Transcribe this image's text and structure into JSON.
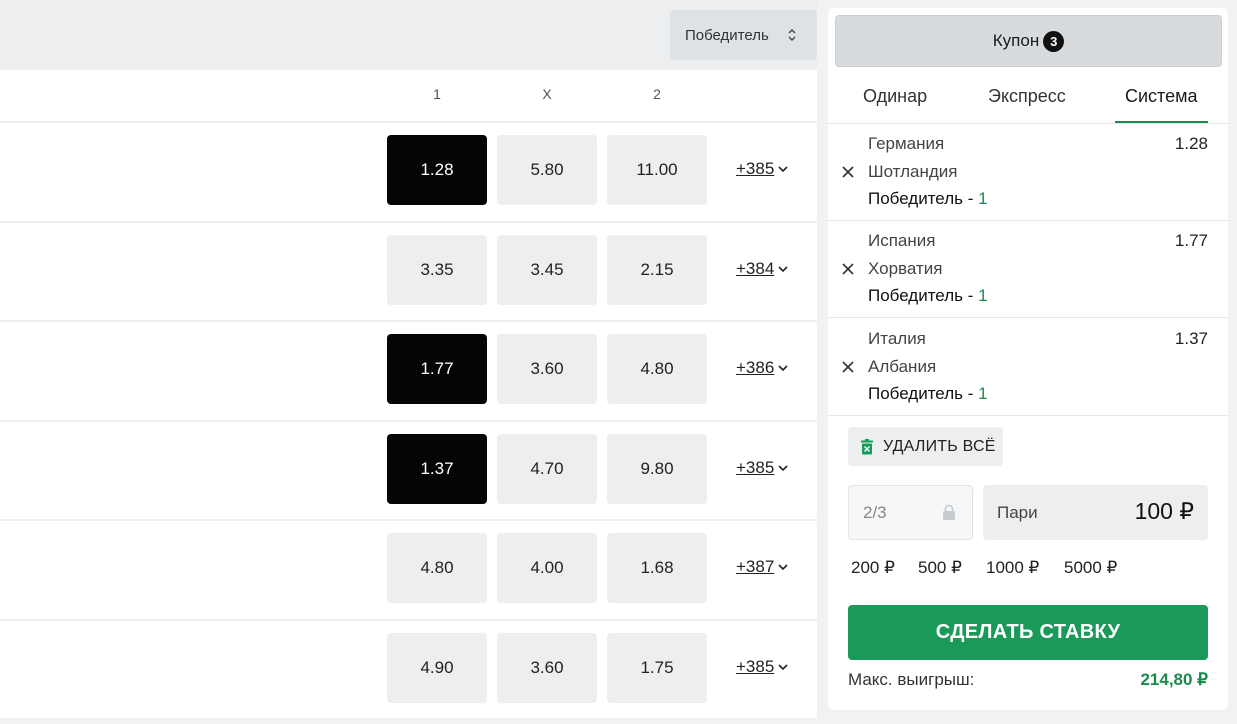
{
  "market_select": {
    "label": "Победитель",
    "icon": "sort-updown-icon"
  },
  "columns": [
    "1",
    "X",
    "2"
  ],
  "events": [
    {
      "odds": [
        "1.28",
        "5.80",
        "11.00"
      ],
      "selected": 0,
      "more": "+385"
    },
    {
      "odds": [
        "3.35",
        "3.45",
        "2.15"
      ],
      "selected": -1,
      "more": "+384"
    },
    {
      "odds": [
        "1.77",
        "3.60",
        "4.80"
      ],
      "selected": 0,
      "more": "+386"
    },
    {
      "odds": [
        "1.37",
        "4.70",
        "9.80"
      ],
      "selected": 0,
      "more": "+385"
    },
    {
      "odds": [
        "4.80",
        "4.00",
        "1.68"
      ],
      "selected": -1,
      "more": "+387"
    },
    {
      "odds": [
        "4.90",
        "3.60",
        "1.75"
      ],
      "selected": -1,
      "more": "+385"
    }
  ],
  "coupon": {
    "title": "Купон",
    "count": "3",
    "tabs": [
      "Одинар",
      "Экспресс",
      "Система"
    ],
    "active_tab": "Система",
    "bets": [
      {
        "team1": "Германия",
        "team2": "Шотландия",
        "market": "Победитель - ",
        "pick": "1",
        "coef": "1.28"
      },
      {
        "team1": "Испания",
        "team2": "Хорватия",
        "market": "Победитель - ",
        "pick": "1",
        "coef": "1.77"
      },
      {
        "team1": "Италия",
        "team2": "Албания",
        "market": "Победитель - ",
        "pick": "1",
        "coef": "1.37"
      }
    ],
    "delete_all": "УДАЛИТЬ ВСЁ",
    "system_value": "2/3",
    "stake_label": "Пари",
    "stake_amount": "100 ₽",
    "quick_amounts": [
      "200 ₽",
      "500 ₽",
      "1000 ₽",
      "5000 ₽"
    ],
    "make_bet": "СДЕЛАТЬ СТАВКУ",
    "max_win_label": "Макс. выигрыш:",
    "max_win_value": "214,80 ₽"
  },
  "colors": {
    "accent_green": "#1a9a58",
    "selected_odd": "#050505"
  }
}
